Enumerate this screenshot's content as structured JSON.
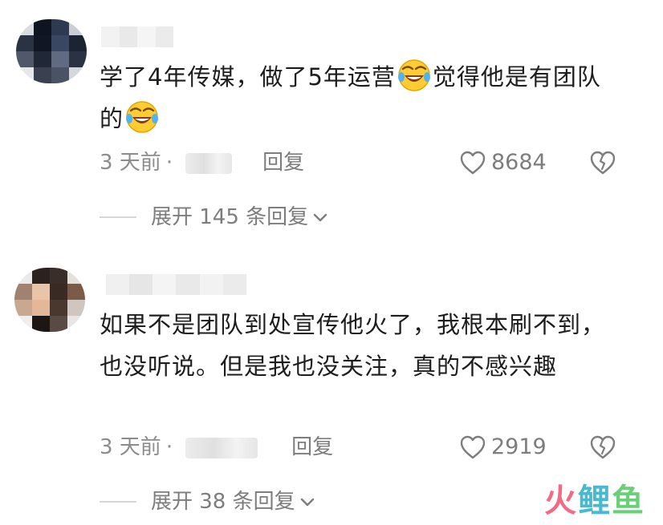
{
  "comments": [
    {
      "text_before_emoji": "学了4年传媒，做了5年运营",
      "text_after_emoji": "觉得他是有团队的",
      "emoji": "laughing-crying-emoji",
      "time": "3 天前",
      "separator": "·",
      "reply_label": "回复",
      "likes": "8684",
      "expand_label": "展开 145 条回复"
    },
    {
      "text": "如果不是团队到处宣传他火了，我根本刷不到，也没听说。但是我也没关注，真的不感兴趣",
      "time": "3 天前",
      "separator": "·",
      "reply_label": "回复",
      "likes": "2919",
      "expand_label": "展开 38 条回复"
    }
  ],
  "watermark": {
    "part1": "火",
    "part2": "鲤",
    "part3": "鱼"
  },
  "colors": {
    "text": "#1d1d1d",
    "meta": "#8c8c8c",
    "watermark_pink": "#f46a84",
    "watermark_blue": "#49b9cf",
    "watermark_green": "#6bcf7a"
  },
  "icons": [
    "heart-outline-icon",
    "broken-heart-icon",
    "chevron-down-icon",
    "laughing-crying-emoji"
  ]
}
